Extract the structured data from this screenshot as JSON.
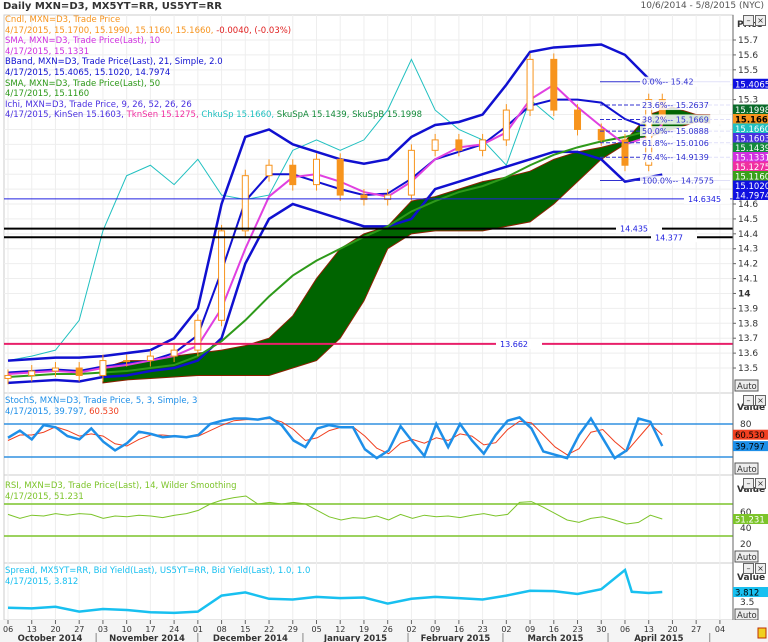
{
  "header": {
    "title": "Daily MXN=D3, MX5YT=RR, US5YT=RR",
    "range": "10/6/2014 - 5/8/2015 (NYC)"
  },
  "legend": {
    "cndl": "Cndl, MXN=D3, Trade Price",
    "cndl_values": "4/17/2015, 15.1700, 15.1990, 15.1160, 15.1660,",
    "cndl_change": "-0.0040, (-0.03%)",
    "sma10": "SMA, MXN=D3, Trade Price(Last),  10",
    "sma10_values": "4/17/2015, 15.1331",
    "bband": "BBand, MXN=D3, Trade Price(Last),  21, Simple, 2.0",
    "bband_values": "4/17/2015, 15.4065, 15.1020, 14.7974",
    "sma50": "SMA, MXN=D3, Trade Price(Last),  50",
    "sma50_values": "4/17/2015, 15.1160",
    "ichi": "Ichi, MXN=D3, Trade Price,  9, 26, 52, 26, 26",
    "ichi_date": "4/17/2015, KinSen 15.1603,",
    "ichi_tkn": "TknSen 15.1275,",
    "ichi_chku": "ChkuSp 15.1660,",
    "ichi_sku": "SkuSpA 15.1439, SkuSpB 15.1998",
    "stoch": "StochS, MXN=D3, Trade Price,  5, 3, Simple, 3",
    "stoch_values": "4/17/2015, 39.797,",
    "stoch_d": "60.530",
    "rsi": "RSI, MXN=D3, Trade Price(Last),  14, Wilder Smoothing",
    "rsi_values": "4/17/2015, 51.231",
    "spread": "Spread, MX5YT=RR, Bid Yield(Last), US5YT=RR, Bid Yield(Last),  1.0, 1.0",
    "spread_values": "4/17/2015, 3.812"
  },
  "axis": {
    "price_label": "Price",
    "value_label": "Value",
    "auto": "Auto"
  },
  "colors": {
    "candle": "#f7941d",
    "sma10": "#e040e0",
    "bband": "#1010d0",
    "sma50": "#2e9a1a",
    "cloud": "#006400",
    "chikou": "#20c0c0",
    "stoch_k": "#1e8fe8",
    "stoch_d": "#f04020",
    "rsi": "#7cc42a",
    "spread": "#18c0f0",
    "line_pink": "#e8206a"
  },
  "chart_data": [
    {
      "type": "candlestick",
      "dates": [
        "2014-10-06",
        "2014-10-13",
        "2014-10-20",
        "2014-10-27",
        "2014-11-03",
        "2014-11-10",
        "2014-11-17",
        "2014-11-24",
        "2014-12-01",
        "2014-12-08",
        "2014-12-15",
        "2014-12-22",
        "2014-12-29",
        "2015-01-05",
        "2015-01-12",
        "2015-01-19",
        "2015-01-26",
        "2015-02-02",
        "2015-02-09",
        "2015-02-16",
        "2015-02-23",
        "2015-03-02",
        "2015-03-09",
        "2015-03-16",
        "2015-03-23",
        "2015-03-30",
        "2015-04-06",
        "2015-04-13",
        "2015-04-17"
      ],
      "close": [
        13.45,
        13.48,
        13.5,
        13.45,
        13.55,
        13.55,
        13.58,
        13.62,
        13.82,
        14.42,
        14.79,
        14.86,
        14.73,
        14.9,
        14.66,
        14.63,
        14.66,
        14.96,
        15.03,
        14.96,
        15.03,
        15.23,
        15.57,
        15.23,
        15.1,
        15.03,
        14.86,
        15.3,
        15.166
      ],
      "sma10": [
        13.46,
        13.47,
        13.48,
        13.47,
        13.5,
        13.52,
        13.55,
        13.58,
        13.65,
        13.9,
        14.3,
        14.65,
        14.78,
        14.8,
        14.75,
        14.68,
        14.65,
        14.75,
        14.9,
        14.98,
        15.0,
        15.08,
        15.3,
        15.4,
        15.25,
        15.12,
        15.0,
        15.05,
        15.1331
      ],
      "bb_upper": [
        13.55,
        13.56,
        13.57,
        13.57,
        13.58,
        13.6,
        13.62,
        13.7,
        13.9,
        14.6,
        15.05,
        15.1,
        15.0,
        14.95,
        14.9,
        14.87,
        14.9,
        15.05,
        15.13,
        15.15,
        15.2,
        15.4,
        15.62,
        15.65,
        15.66,
        15.67,
        15.6,
        15.44,
        15.4065
      ],
      "bb_mid": [
        13.47,
        13.48,
        13.49,
        13.48,
        13.51,
        13.53,
        13.55,
        13.6,
        13.72,
        14.15,
        14.62,
        14.8,
        14.8,
        14.75,
        14.7,
        14.66,
        14.67,
        14.77,
        14.9,
        14.95,
        15.0,
        15.12,
        15.26,
        15.3,
        15.3,
        15.28,
        15.17,
        15.11,
        15.102
      ],
      "bb_lower": [
        13.4,
        13.41,
        13.42,
        13.41,
        13.44,
        13.45,
        13.48,
        13.5,
        13.55,
        13.7,
        14.2,
        14.5,
        14.6,
        14.55,
        14.5,
        14.45,
        14.45,
        14.5,
        14.7,
        14.75,
        14.8,
        14.85,
        14.9,
        14.95,
        14.95,
        14.9,
        14.75,
        14.78,
        14.7974
      ],
      "sma50": [
        13.44,
        13.45,
        13.46,
        13.46,
        13.47,
        13.48,
        13.5,
        13.52,
        13.58,
        13.68,
        13.82,
        13.98,
        14.12,
        14.22,
        14.3,
        14.38,
        14.45,
        14.55,
        14.62,
        14.68,
        14.72,
        14.78,
        14.86,
        14.93,
        14.98,
        15.02,
        15.05,
        15.09,
        15.116
      ],
      "cloud_dates": [
        "2014-11-03",
        "2014-11-10",
        "2014-11-17",
        "2014-11-24",
        "2014-12-01",
        "2014-12-08",
        "2014-12-15",
        "2014-12-22",
        "2014-12-29",
        "2015-01-05",
        "2015-01-12",
        "2015-01-19",
        "2015-01-26",
        "2015-02-02",
        "2015-02-09",
        "2015-02-16",
        "2015-02-23",
        "2015-03-02",
        "2015-03-09",
        "2015-03-16",
        "2015-03-23",
        "2015-03-30",
        "2015-04-06",
        "2015-04-13",
        "2015-04-20",
        "2015-04-27",
        "2015-05-01"
      ],
      "span_a": [
        13.5,
        13.55,
        13.55,
        13.58,
        13.6,
        13.62,
        13.65,
        13.7,
        13.85,
        14.1,
        14.3,
        14.4,
        14.45,
        14.62,
        14.65,
        14.7,
        14.75,
        14.78,
        14.82,
        14.9,
        14.95,
        14.98,
        15.02,
        15.2,
        15.25,
        15.2,
        15.1439
      ],
      "span_b": [
        13.4,
        13.42,
        13.43,
        13.44,
        13.45,
        13.45,
        13.45,
        13.45,
        13.5,
        13.55,
        13.7,
        13.95,
        14.3,
        14.4,
        14.42,
        14.42,
        14.42,
        14.45,
        14.48,
        14.6,
        14.75,
        14.9,
        15.0,
        15.05,
        15.1,
        15.15,
        15.1998
      ],
      "hlines": [
        14.6345,
        14.435,
        14.377,
        13.662
      ],
      "fib": [
        {
          "label": "0.0%",
          "value": 15.42
        },
        {
          "label": "23.6%",
          "value": 15.2637
        },
        {
          "label": "38.2%",
          "value": 15.1669
        },
        {
          "label": "50.0%",
          "value": 15.0888
        },
        {
          "label": "61.8%",
          "value": 15.0106
        },
        {
          "label": "76.4%",
          "value": 14.9139
        },
        {
          "label": "100.0%",
          "value": 14.7575
        }
      ],
      "last_labels": [
        {
          "text": "15.4065",
          "color": "#1010e0",
          "value": 15.4065
        },
        {
          "text": "15.1998",
          "color": "#0a6a2a",
          "value": 15.1998
        },
        {
          "text": "15.1660",
          "color": "#f7941d",
          "value": 15.166
        },
        {
          "text": "15.1660",
          "color": "#20c0c0",
          "value": 15.166
        },
        {
          "text": "15.1603",
          "color": "#4a30e0",
          "value": 15.1603
        },
        {
          "text": "15.1439",
          "color": "#138a3a",
          "value": 15.1439
        },
        {
          "text": "15.1331",
          "color": "#d030e0",
          "value": 15.1331
        },
        {
          "text": "15.1275",
          "color": "#f030a0",
          "value": 15.1275
        },
        {
          "text": "15.1160",
          "color": "#3aa01a",
          "value": 15.116
        },
        {
          "text": "15.1020",
          "color": "#1010e0",
          "value": 15.102
        },
        {
          "text": "14.7974",
          "color": "#1010e0",
          "value": 14.7974
        }
      ],
      "y_ticks": [
        "15.7",
        "15.6",
        "15.5",
        "15.3",
        "14.6",
        "14.5",
        "14.4",
        "14.3",
        "14.2",
        "14.1",
        "14",
        "13.9",
        "13.8",
        "13.7",
        "13.6",
        "13.5"
      ],
      "ylim": [
        13.45,
        15.85
      ]
    },
    {
      "type": "line",
      "panel": "stochastic",
      "ylim": [
        0,
        100
      ],
      "levels": [
        80,
        20
      ],
      "y_ticks": [
        "80"
      ],
      "k": [
        55,
        68,
        52,
        78,
        74,
        58,
        52,
        72,
        48,
        32,
        45,
        66,
        62,
        56,
        58,
        56,
        60,
        80,
        86,
        90,
        90,
        88,
        92,
        78,
        50,
        38,
        72,
        78,
        74,
        74,
        34,
        18,
        32,
        76,
        48,
        22,
        80,
        38,
        80,
        50,
        26,
        60,
        86,
        92,
        72,
        30,
        24,
        18,
        60,
        90,
        54,
        18,
        32,
        90,
        84,
        39.797
      ],
      "d": [
        50,
        60,
        60,
        65,
        75,
        68,
        58,
        62,
        58,
        44,
        40,
        52,
        60,
        60,
        58,
        57,
        58,
        68,
        78,
        86,
        88,
        88,
        90,
        84,
        70,
        50,
        55,
        68,
        74,
        75,
        58,
        36,
        26,
        45,
        52,
        45,
        55,
        50,
        62,
        58,
        42,
        46,
        70,
        85,
        82,
        60,
        38,
        24,
        35,
        65,
        70,
        48,
        30,
        55,
        80,
        60.53
      ]
    },
    {
      "type": "line",
      "panel": "rsi",
      "ylim": [
        0,
        90
      ],
      "levels": [
        70,
        30
      ],
      "y_ticks": [
        "60",
        "40",
        "20"
      ],
      "values": [
        57,
        52,
        56,
        55,
        58,
        56,
        58,
        57,
        52,
        55,
        54,
        56,
        55,
        53,
        56,
        58,
        62,
        70,
        75,
        78,
        80,
        70,
        72,
        70,
        72,
        70,
        62,
        54,
        50,
        53,
        52,
        55,
        50,
        57,
        52,
        56,
        54,
        55,
        53,
        56,
        58,
        55,
        57,
        72,
        73,
        66,
        58,
        50,
        47,
        52,
        54,
        50,
        45,
        47,
        56,
        51.231
      ]
    },
    {
      "type": "line",
      "panel": "spread",
      "y_ticks": [
        "3.5"
      ],
      "ylim": [
        2.9,
        4.8
      ],
      "dates": [
        "2014-10-06",
        "2014-10-13",
        "2014-10-20",
        "2014-10-27",
        "2014-11-03",
        "2014-11-10",
        "2014-11-17",
        "2014-11-24",
        "2014-12-01",
        "2014-12-08",
        "2014-12-15",
        "2014-12-22",
        "2014-12-29",
        "2015-01-05",
        "2015-01-12",
        "2015-01-19",
        "2015-01-26",
        "2015-02-02",
        "2015-02-09",
        "2015-02-16",
        "2015-02-23",
        "2015-03-02",
        "2015-03-09",
        "2015-03-16",
        "2015-03-23",
        "2015-03-30",
        "2015-04-06",
        "2015-04-08",
        "2015-04-13",
        "2015-04-17"
      ],
      "values": [
        3.32,
        3.3,
        3.35,
        3.2,
        3.28,
        3.25,
        3.18,
        3.16,
        3.2,
        3.7,
        3.8,
        3.6,
        3.58,
        3.66,
        3.62,
        3.64,
        3.45,
        3.6,
        3.66,
        3.62,
        3.58,
        3.7,
        3.85,
        3.84,
        3.75,
        3.9,
        4.5,
        3.82,
        3.78,
        3.812
      ]
    }
  ],
  "x_axis": {
    "day_ticks": [
      {
        "d": "2014-10-06",
        "t": "06"
      },
      {
        "d": "2014-10-13",
        "t": "13"
      },
      {
        "d": "2014-10-20",
        "t": "20"
      },
      {
        "d": "2014-10-27",
        "t": "27"
      },
      {
        "d": "2014-11-03",
        "t": "03"
      },
      {
        "d": "2014-11-10",
        "t": "10"
      },
      {
        "d": "2014-11-17",
        "t": "17"
      },
      {
        "d": "2014-11-24",
        "t": "24"
      },
      {
        "d": "2014-12-01",
        "t": "01"
      },
      {
        "d": "2014-12-08",
        "t": "08"
      },
      {
        "d": "2014-12-15",
        "t": "15"
      },
      {
        "d": "2014-12-22",
        "t": "22"
      },
      {
        "d": "2014-12-29",
        "t": "29"
      },
      {
        "d": "2015-01-05",
        "t": "05"
      },
      {
        "d": "2015-01-12",
        "t": "12"
      },
      {
        "d": "2015-01-19",
        "t": "19"
      },
      {
        "d": "2015-01-26",
        "t": "26"
      },
      {
        "d": "2015-02-02",
        "t": "02"
      },
      {
        "d": "2015-02-09",
        "t": "09"
      },
      {
        "d": "2015-02-16",
        "t": "16"
      },
      {
        "d": "2015-02-23",
        "t": "23"
      },
      {
        "d": "2015-03-02",
        "t": "02"
      },
      {
        "d": "2015-03-09",
        "t": "09"
      },
      {
        "d": "2015-03-16",
        "t": "16"
      },
      {
        "d": "2015-03-23",
        "t": "23"
      },
      {
        "d": "2015-03-30",
        "t": "30"
      },
      {
        "d": "2015-04-06",
        "t": "06"
      },
      {
        "d": "2015-04-13",
        "t": "13"
      },
      {
        "d": "2015-04-20",
        "t": "20"
      },
      {
        "d": "2015-04-27",
        "t": "27"
      },
      {
        "d": "2015-05-04",
        "t": "04"
      }
    ],
    "months": [
      {
        "t": "October 2014",
        "from": "2014-10-01",
        "to": "2014-11-01"
      },
      {
        "t": "November 2014",
        "from": "2014-11-01",
        "to": "2014-12-01"
      },
      {
        "t": "December 2014",
        "from": "2014-12-01",
        "to": "2015-01-01"
      },
      {
        "t": "January 2015",
        "from": "2015-01-01",
        "to": "2015-02-01"
      },
      {
        "t": "February 2015",
        "from": "2015-02-01",
        "to": "2015-03-01"
      },
      {
        "t": "March 2015",
        "from": "2015-03-01",
        "to": "2015-04-01"
      },
      {
        "t": "April 2015",
        "from": "2015-04-01",
        "to": "2015-05-01"
      }
    ]
  }
}
